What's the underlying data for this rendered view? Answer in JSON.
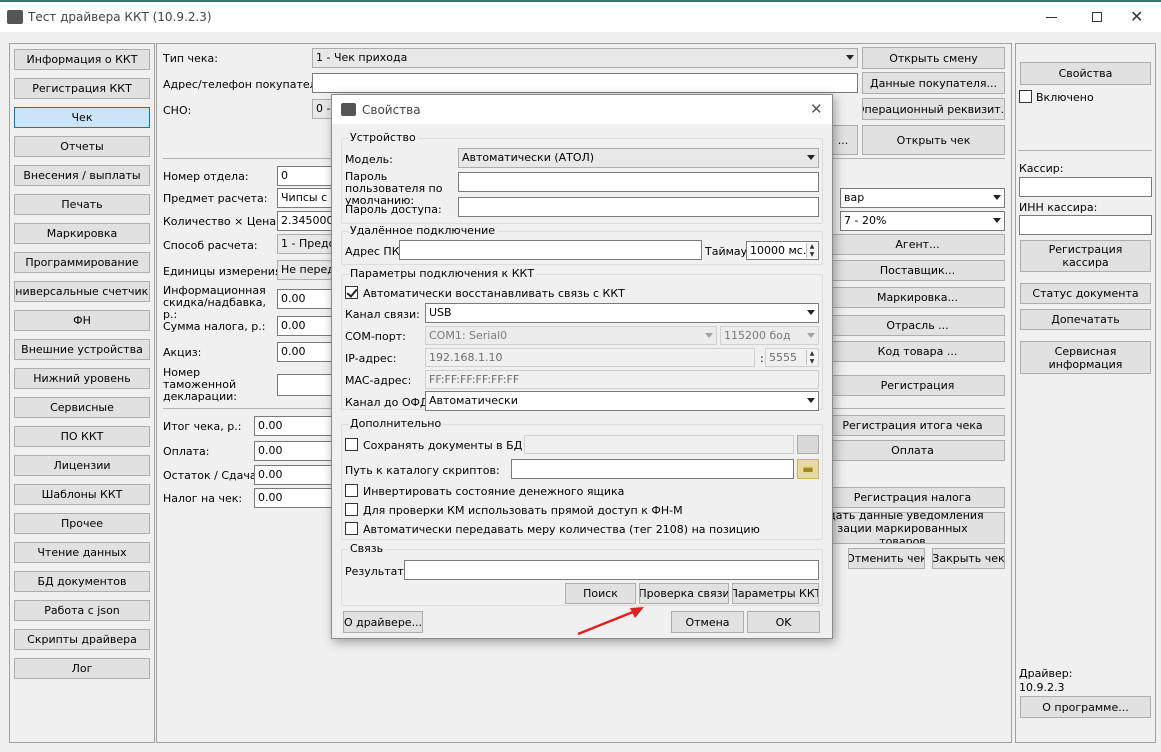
{
  "window": {
    "title": "Тест драйвера ККТ (10.9.2.3)"
  },
  "left_nav": [
    "Информация о ККТ",
    "Регистрация ККТ",
    "Чек",
    "Отчеты",
    "Внесения / выплаты",
    "Печать",
    "Маркировка",
    "Программирование",
    "Универсальные счетчики",
    "ФН",
    "Внешние устройства",
    "Нижний уровень",
    "Сервисные",
    "ПО ККТ",
    "Лицензии",
    "Шаблоны ККТ",
    "Прочее",
    "Чтение данных",
    "БД документов",
    "Работа с json",
    "Скрипты драйвера",
    "Лог"
  ],
  "main": {
    "receipt_type_label": "Тип чека:",
    "receipt_type_value": "1 - Чек прихода",
    "buyer_label": "Адрес/телефон покупателя:",
    "sno_label": "СНО:",
    "sno_value": "0 -",
    "dept_label": "Номер отдела:",
    "dept_value": "0",
    "subject_label": "Предмет расчета:",
    "subject_value": "Чипсы с бе",
    "subject_right": "вар",
    "qty_label": "Количество × Цена:",
    "qty_value": "2.345000",
    "vat_value": "7 - 20%",
    "method_label": "Способ расчета:",
    "method_value": "1 - Предоп",
    "units_label": "Единицы измерения:",
    "units_value": "Не переда",
    "discount_label": "Информационная скидка/надбавка, р.:",
    "discount_value": "0.00",
    "tax_sum_label": "Сумма налога, р.:",
    "tax_sum_value": "0.00",
    "excise_label": "Акциз:",
    "excise_value": "0.00",
    "customs_label": "Номер таможенной декларации:",
    "total_label": "Итог чека, р.:",
    "total_value": "0.00",
    "payment_label": "Оплата:",
    "payment_value": "0.00",
    "change_label": "Остаток / Сдача:",
    "change_value": "0.00",
    "receipt_tax_label": "Налог на чек:",
    "receipt_tax_value": "0.00",
    "buttons": {
      "open_shift": "Открыть смену",
      "buyer_data": "Данные покупателя...",
      "op_requisite": "Операционный реквизит...",
      "dots": "...",
      "open_receipt": "Открыть чек",
      "agent": "Агент...",
      "supplier": "Поставщик...",
      "marking": "Маркировка...",
      "industry": "Отрасль ...",
      "product_code": "Код товара ...",
      "registration": "Регистрация",
      "reg_total": "Регистрация итога чека",
      "pay": "Оплата",
      "reg_tax": "Регистрация налога",
      "send_notice": "едать данные уведомления\nзации маркированных товаров",
      "cancel_receipt": "Отменить чек",
      "close_receipt": "Закрыть чек"
    }
  },
  "right_panel": {
    "properties": "Свойства",
    "enabled": "Включено",
    "cashier_label": "Кассир:",
    "inn_label": "ИНН кассира:",
    "reg_cashier": "Регистрация\nкассира",
    "doc_status": "Статус документа",
    "reprint": "Допечатать",
    "service_info": "Сервисная\nинформация",
    "driver_label": "Драйвер:",
    "driver_version": "10.9.2.3",
    "about": "О программе..."
  },
  "dialog": {
    "title": "Свойства",
    "device_group": "Устройство",
    "model_label": "Модель:",
    "model_value": "Автоматически (АТОЛ)",
    "user_pwd_label": "Пароль пользователя по умолчанию:",
    "access_pwd_label": "Пароль доступа:",
    "remote_group": "Удалённое подключение",
    "pc_addr_label": "Адрес ПК:",
    "timeout_label": "Таймаут",
    "timeout_value": "10000 мс.",
    "conn_group": "Параметры подключения к ККТ",
    "auto_restore": "Автоматически восстанавливать связь с ККТ",
    "channel_label": "Канал связи:",
    "channel_value": "USB",
    "com_label": "COM-порт:",
    "com_value": "COM1: Serial0",
    "baud_value": "115200 бод",
    "ip_label": "IP-адрес:",
    "ip_value": "192.168.1.10",
    "port_sep": ":",
    "port_value": "5555",
    "mac_label": "MAC-адрес:",
    "mac_value": "FF:FF:FF:FF:FF:FF",
    "ofd_label": "Канал до ОФД:",
    "ofd_value": "Автоматически",
    "extra_group": "Дополнительно",
    "save_docs": "Сохранять документы в БД",
    "scripts_label": "Путь к каталогу скриптов:",
    "invert_drawer": "Инвертировать состояние денежного ящика",
    "km_direct": "Для проверки КМ использовать прямой доступ к ФН-М",
    "auto_tag": "Автоматически передавать меру количества (тег 2108) на позицию",
    "link_group": "Связь",
    "result_label": "Результат:",
    "search_btn": "Поиск",
    "check_btn": "Проверка связи",
    "params_btn": "Параметры ККТ",
    "about_btn": "О драйвере...",
    "cancel_btn": "Отмена",
    "ok_btn": "OK"
  },
  "colors": {
    "accent": "#0078d7",
    "arrow": "#e02020"
  }
}
